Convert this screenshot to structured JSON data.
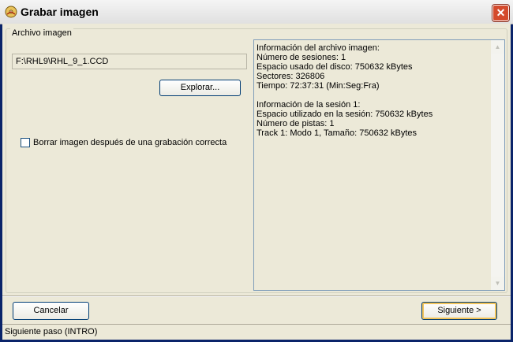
{
  "window": {
    "title": "Grabar imagen"
  },
  "group": {
    "label": "Archivo imagen"
  },
  "path": {
    "value": "F:\\RHL9\\RHL_9_1.CCD"
  },
  "explore_label": "Explorar...",
  "checkbox": {
    "label": "Borrar imagen después de una grabación correcta",
    "checked": false
  },
  "info_lines": [
    "Información del archivo imagen:",
    "Número de sesiones: 1",
    "Espacio usado del disco: 750632 kBytes",
    "Sectores: 326806",
    "Tiempo: 72:37:31 (Min:Seg:Fra)",
    "",
    "Información de la sesión 1:",
    "Espacio utilizado en la sesión: 750632 kBytes",
    "Número de pistas: 1",
    "Track 1: Modo 1, Tamaño: 750632 kBytes"
  ],
  "buttons": {
    "cancel": "Cancelar",
    "next": "Siguiente >"
  },
  "status": "Siguiente paso (INTRO)",
  "colors": {
    "title_bg": "#f0f0f0",
    "client_bg": "#ece9d8",
    "close": "#d44a2c",
    "default_btn_highlight": "#f1c35a"
  },
  "icons": {
    "title": "burn-disc-icon",
    "close": "close-icon"
  }
}
